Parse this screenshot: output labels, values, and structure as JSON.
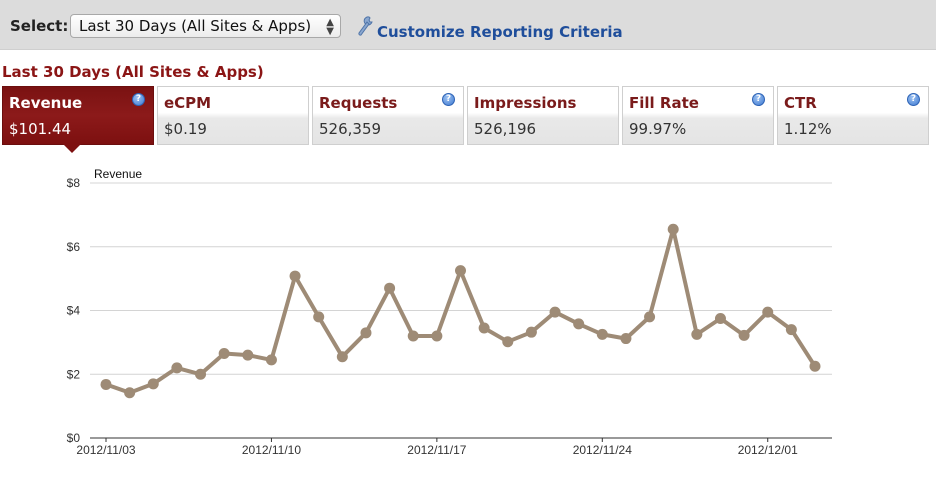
{
  "toolbar": {
    "select_label": "Select:",
    "selected_range": "Last 30 Days (All Sites & Apps)",
    "customize_link": "Customize Reporting Criteria"
  },
  "section_title": "Last 30 Days (All Sites & Apps)",
  "metrics": [
    {
      "label": "Revenue",
      "value": "$101.44",
      "active": true,
      "help": true
    },
    {
      "label": "eCPM",
      "value": "$0.19",
      "active": false,
      "help": false
    },
    {
      "label": "Requests",
      "value": "526,359",
      "active": false,
      "help": true
    },
    {
      "label": "Impressions",
      "value": "526,196",
      "active": false,
      "help": false
    },
    {
      "label": "Fill Rate",
      "value": "99.97%",
      "active": false,
      "help": true
    },
    {
      "label": "CTR",
      "value": "1.12%",
      "active": false,
      "help": true
    }
  ],
  "colors": {
    "accent": "#8b1515",
    "link": "#1f4e9b",
    "series": "#9e8b76"
  },
  "chart_data": {
    "type": "line",
    "title": "Revenue",
    "ylim": [
      0,
      8
    ],
    "yticks": [
      "$0",
      "$2",
      "$4",
      "$6",
      "$8"
    ],
    "ytick_values": [
      0,
      2,
      4,
      6,
      8
    ],
    "xtick_labels": [
      "2012/11/03",
      "2012/11/10",
      "2012/11/17",
      "2012/11/24",
      "2012/12/01"
    ],
    "xtick_index": [
      0,
      7,
      14,
      21,
      28
    ],
    "grid": true,
    "series": [
      {
        "x": [
          "2012/11/03",
          "2012/11/04",
          "2012/11/05",
          "2012/11/06",
          "2012/11/07",
          "2012/11/08",
          "2012/11/09",
          "2012/11/10",
          "2012/11/11",
          "2012/11/12",
          "2012/11/13",
          "2012/11/14",
          "2012/11/15",
          "2012/11/16",
          "2012/11/17",
          "2012/11/18",
          "2012/11/19",
          "2012/11/20",
          "2012/11/21",
          "2012/11/22",
          "2012/11/23",
          "2012/11/24",
          "2012/11/25",
          "2012/11/26",
          "2012/11/27",
          "2012/11/28",
          "2012/11/29",
          "2012/11/30",
          "2012/12/01",
          "2012/12/02",
          "2012/12/03"
        ],
        "values": [
          1.68,
          1.42,
          1.7,
          2.2,
          2.0,
          2.65,
          2.6,
          2.45,
          5.08,
          3.8,
          2.55,
          3.3,
          4.7,
          3.2,
          3.2,
          5.25,
          3.45,
          3.02,
          3.32,
          3.95,
          3.58,
          3.25,
          3.12,
          3.8,
          6.55,
          3.25,
          3.75,
          3.22,
          3.95,
          3.4,
          2.25
        ]
      }
    ]
  }
}
